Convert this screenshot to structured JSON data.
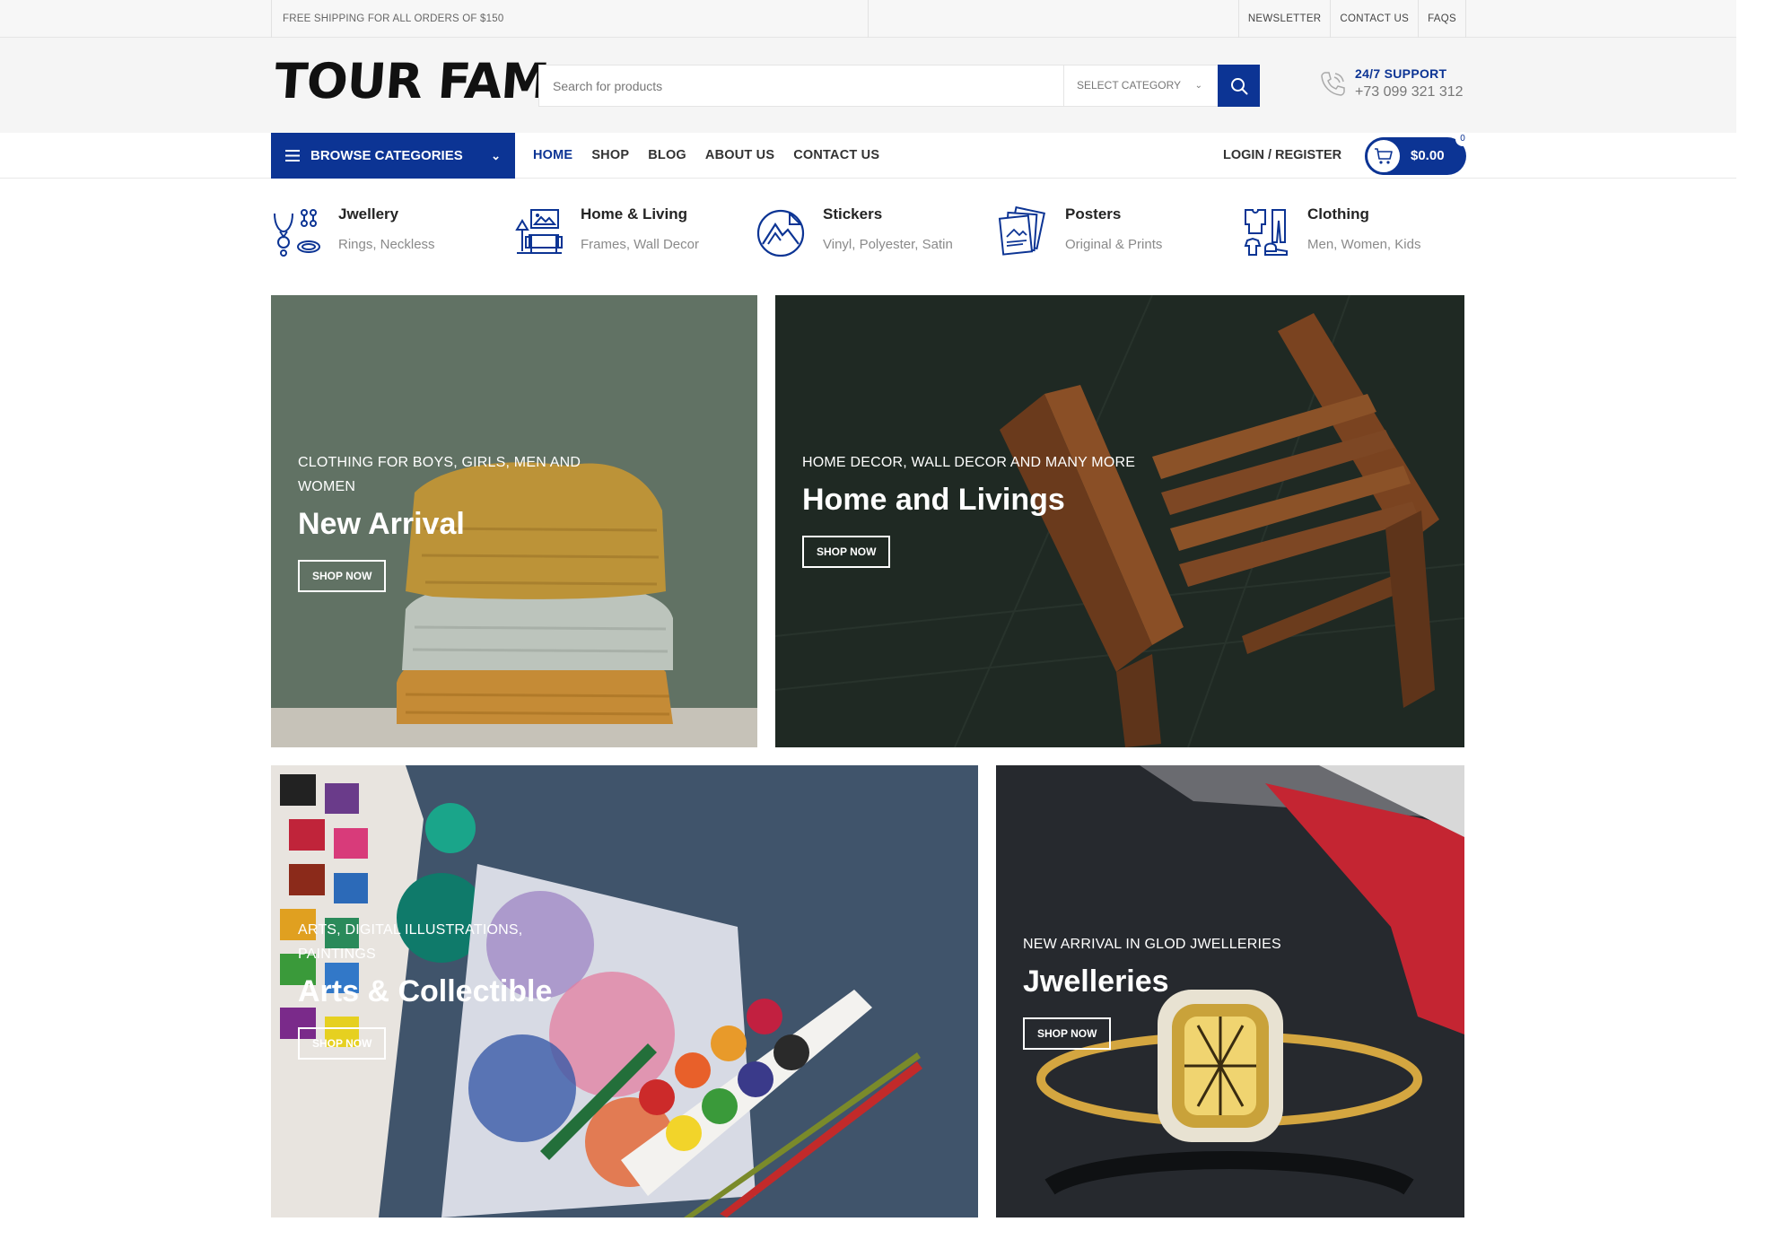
{
  "topbar": {
    "shipping": "FREE SHIPPING FOR ALL ORDERS OF $150",
    "links": [
      "NEWSLETTER",
      "CONTACT US",
      "FAQS"
    ]
  },
  "header": {
    "logo": "TOUR FAM",
    "search_placeholder": "Search for products",
    "category_select": "SELECT CATEGORY",
    "support_title": "24/7 SUPPORT",
    "support_phone": "+73 099 321 312"
  },
  "nav": {
    "browse": "BROWSE CATEGORIES",
    "menu": [
      "HOME",
      "SHOP",
      "BLOG",
      "ABOUT US",
      "CONTACT US"
    ],
    "active_index": 0,
    "login": "LOGIN / REGISTER",
    "cart_total": "$0.00",
    "cart_count": "0"
  },
  "categories": [
    {
      "name": "Jwellery",
      "sub": "Rings, Neckless",
      "icon": "jewellery-icon"
    },
    {
      "name": "Home & Living",
      "sub": "Frames, Wall Decor",
      "icon": "home-living-icon"
    },
    {
      "name": "Stickers",
      "sub": "Vinyl, Polyester, Satin",
      "icon": "stickers-icon"
    },
    {
      "name": "Posters",
      "sub": "Original & Prints",
      "icon": "posters-icon"
    },
    {
      "name": "Clothing",
      "sub": "Men, Women, Kids",
      "icon": "clothing-icon"
    }
  ],
  "banners": [
    {
      "sub": "CLOTHING FOR BOYS, GIRLS, MEN AND WOMEN",
      "title": "New Arrival",
      "button": "SHOP NOW"
    },
    {
      "sub": "HOME DECOR, WALL DECOR AND MANY MORE",
      "title": "Home and Livings",
      "button": "SHOP NOW"
    },
    {
      "sub": "ARTS, DIGITAL ILLUSTRATIONS, PAINTINGS",
      "title": "Arts & Collectible",
      "button": "SHOP NOW"
    },
    {
      "sub": "NEW ARRIVAL IN GLOD JWELLERIES",
      "title": "Jwelleries",
      "button": "SHOP NOW"
    }
  ],
  "colors": {
    "accent": "#0c3494"
  }
}
